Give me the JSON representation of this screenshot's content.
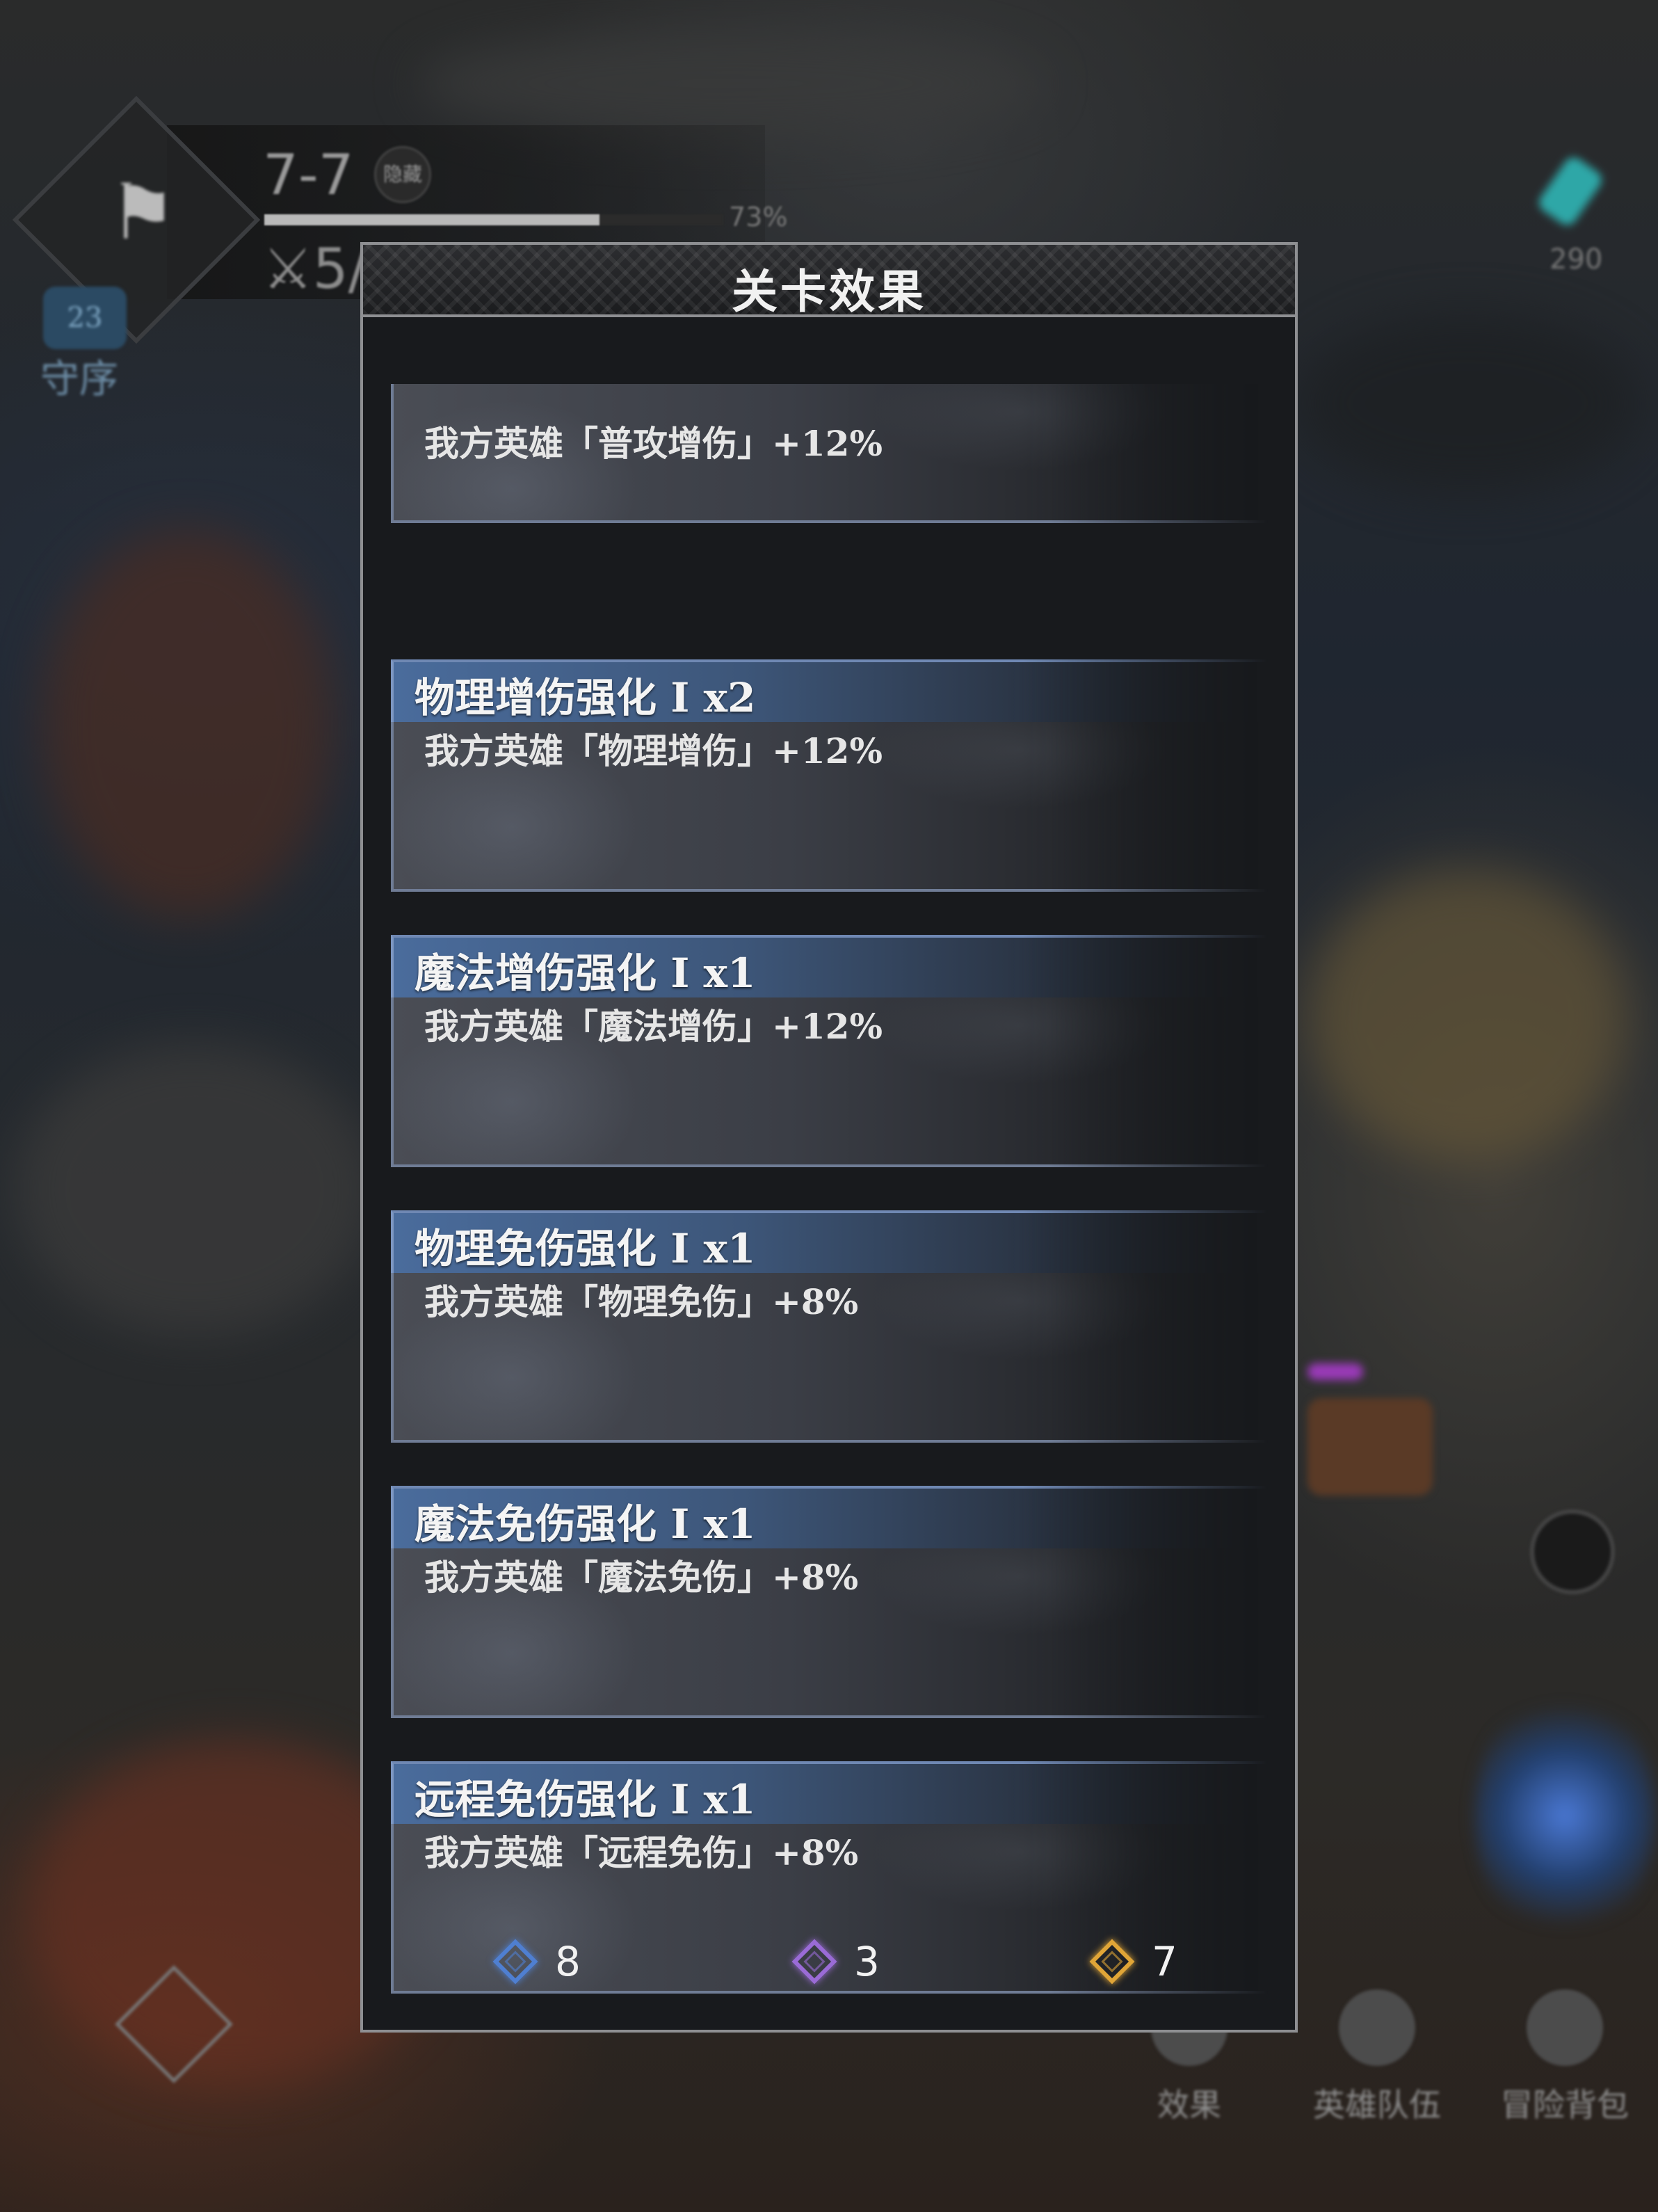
{
  "hud": {
    "stage": "7-7",
    "badge": "隐藏",
    "progress_pct": 73,
    "progress_label": "73%",
    "kills": "5/",
    "level": "23",
    "level_label": "守序",
    "resource_count": "290",
    "bottom_buttons": [
      "效果",
      "英雄队伍",
      "冒险背包"
    ]
  },
  "panel": {
    "title": "关卡效果",
    "effects": [
      {
        "title": "",
        "desc": "我方英雄「普攻增伤」+12%"
      },
      {
        "title": "物理增伤强化 I  x2",
        "desc": "我方英雄「物理增伤」+12%"
      },
      {
        "title": "魔法增伤强化 I  x1",
        "desc": "我方英雄「魔法增伤」+12%"
      },
      {
        "title": "物理免伤强化 I  x1",
        "desc": "我方英雄「物理免伤」+8%"
      },
      {
        "title": "魔法免伤强化 I  x1",
        "desc": "我方英雄「魔法免伤」+8%"
      },
      {
        "title": "远程免伤强化 I  x1",
        "desc": "我方英雄「远程免伤」+8%"
      }
    ],
    "currencies": [
      {
        "icon": "blue-gem-icon",
        "color": "#4f7fd1",
        "value": "8"
      },
      {
        "icon": "purple-gem-icon",
        "color": "#9a6bd6",
        "value": "3"
      },
      {
        "icon": "gold-gem-icon",
        "color": "#e0a537",
        "value": "7"
      }
    ]
  }
}
